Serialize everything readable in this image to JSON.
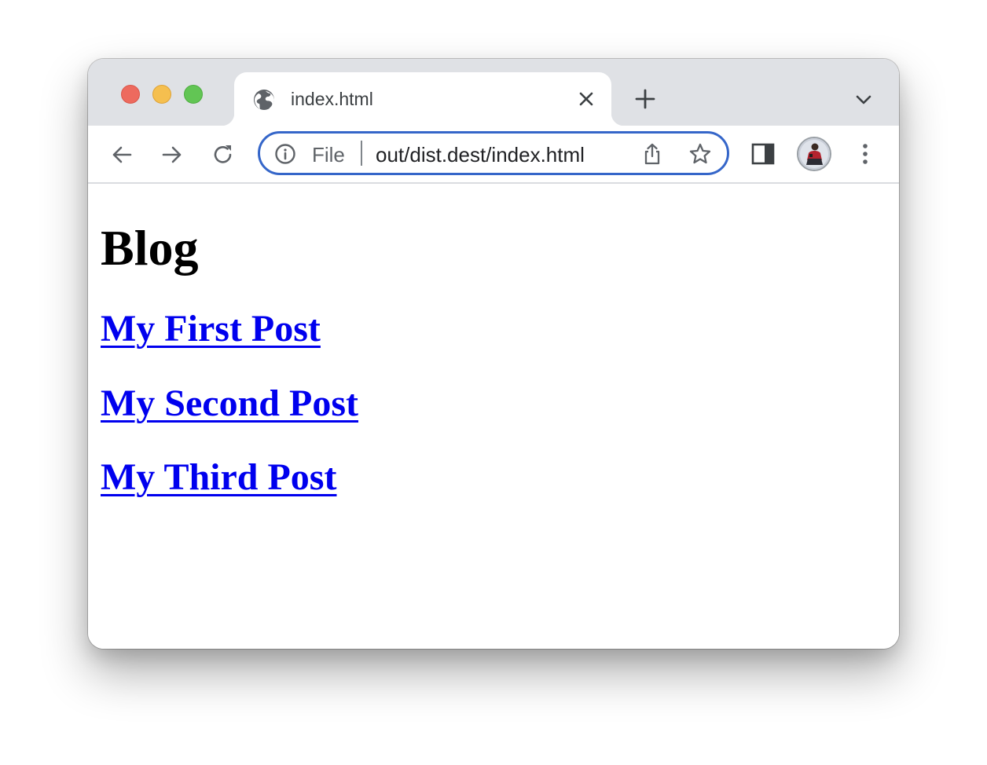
{
  "browser": {
    "tab": {
      "title": "index.html",
      "favicon": "globe-icon"
    },
    "omnibox": {
      "scheme_label": "File",
      "url": "out/dist.dest/index.html"
    },
    "icons": {
      "back": "arrow-left-icon",
      "forward": "arrow-right-icon",
      "reload": "reload-icon",
      "info": "info-icon",
      "share": "share-icon",
      "bookmark": "star-icon",
      "side_panel": "side-panel-icon",
      "menu": "more-vertical-icon",
      "new_tab": "plus-icon",
      "tab_search": "chevron-down-icon",
      "close_tab": "close-icon"
    },
    "colors": {
      "tabstrip": "#dfe1e5",
      "omnibox_focus": "#3566c9",
      "traffic_red": "#ed6a5e",
      "traffic_yellow": "#f5bf4f",
      "traffic_green": "#62c554"
    }
  },
  "page": {
    "title": "Blog",
    "posts": [
      {
        "label": "My First Post"
      },
      {
        "label": "My Second Post"
      },
      {
        "label": "My Third Post"
      }
    ],
    "link_color": "#0000ee"
  }
}
